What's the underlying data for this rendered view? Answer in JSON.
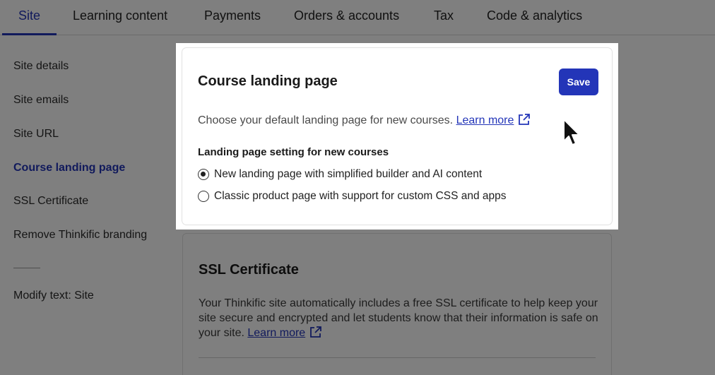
{
  "tabs": [
    {
      "label": "Site",
      "active": true
    },
    {
      "label": "Learning content"
    },
    {
      "label": "Payments"
    },
    {
      "label": "Orders & accounts"
    },
    {
      "label": "Tax"
    },
    {
      "label": "Code & analytics"
    }
  ],
  "sidebar": {
    "items": [
      {
        "label": "Site details"
      },
      {
        "label": "Site emails"
      },
      {
        "label": "Site URL"
      },
      {
        "label": "Course landing page",
        "active": true
      },
      {
        "label": "SSL Certificate"
      },
      {
        "label": "Remove Thinkific branding"
      }
    ],
    "modify_text": "Modify text: Site"
  },
  "landing_card": {
    "title": "Course landing page",
    "save_label": "Save",
    "description": "Choose your default landing page for new courses.",
    "learn_more": "Learn more",
    "setting_label": "Landing page setting for new courses",
    "options": [
      {
        "label": "New landing page with simplified builder and AI content",
        "selected": true
      },
      {
        "label": "Classic product page with support for custom CSS and apps",
        "selected": false
      }
    ]
  },
  "ssl_card": {
    "title": "SSL Certificate",
    "description": "Your Thinkific site automatically includes a free SSL certificate to help keep your site secure and encrypted and let students know that their information is safe on your site.",
    "learn_more": "Learn more"
  },
  "colors": {
    "accent": "#2335b8",
    "overlay": "rgba(0,0,0,0.5)"
  },
  "icons": {
    "external_link": "external-link-icon",
    "cursor": "mouse-pointer-icon"
  }
}
